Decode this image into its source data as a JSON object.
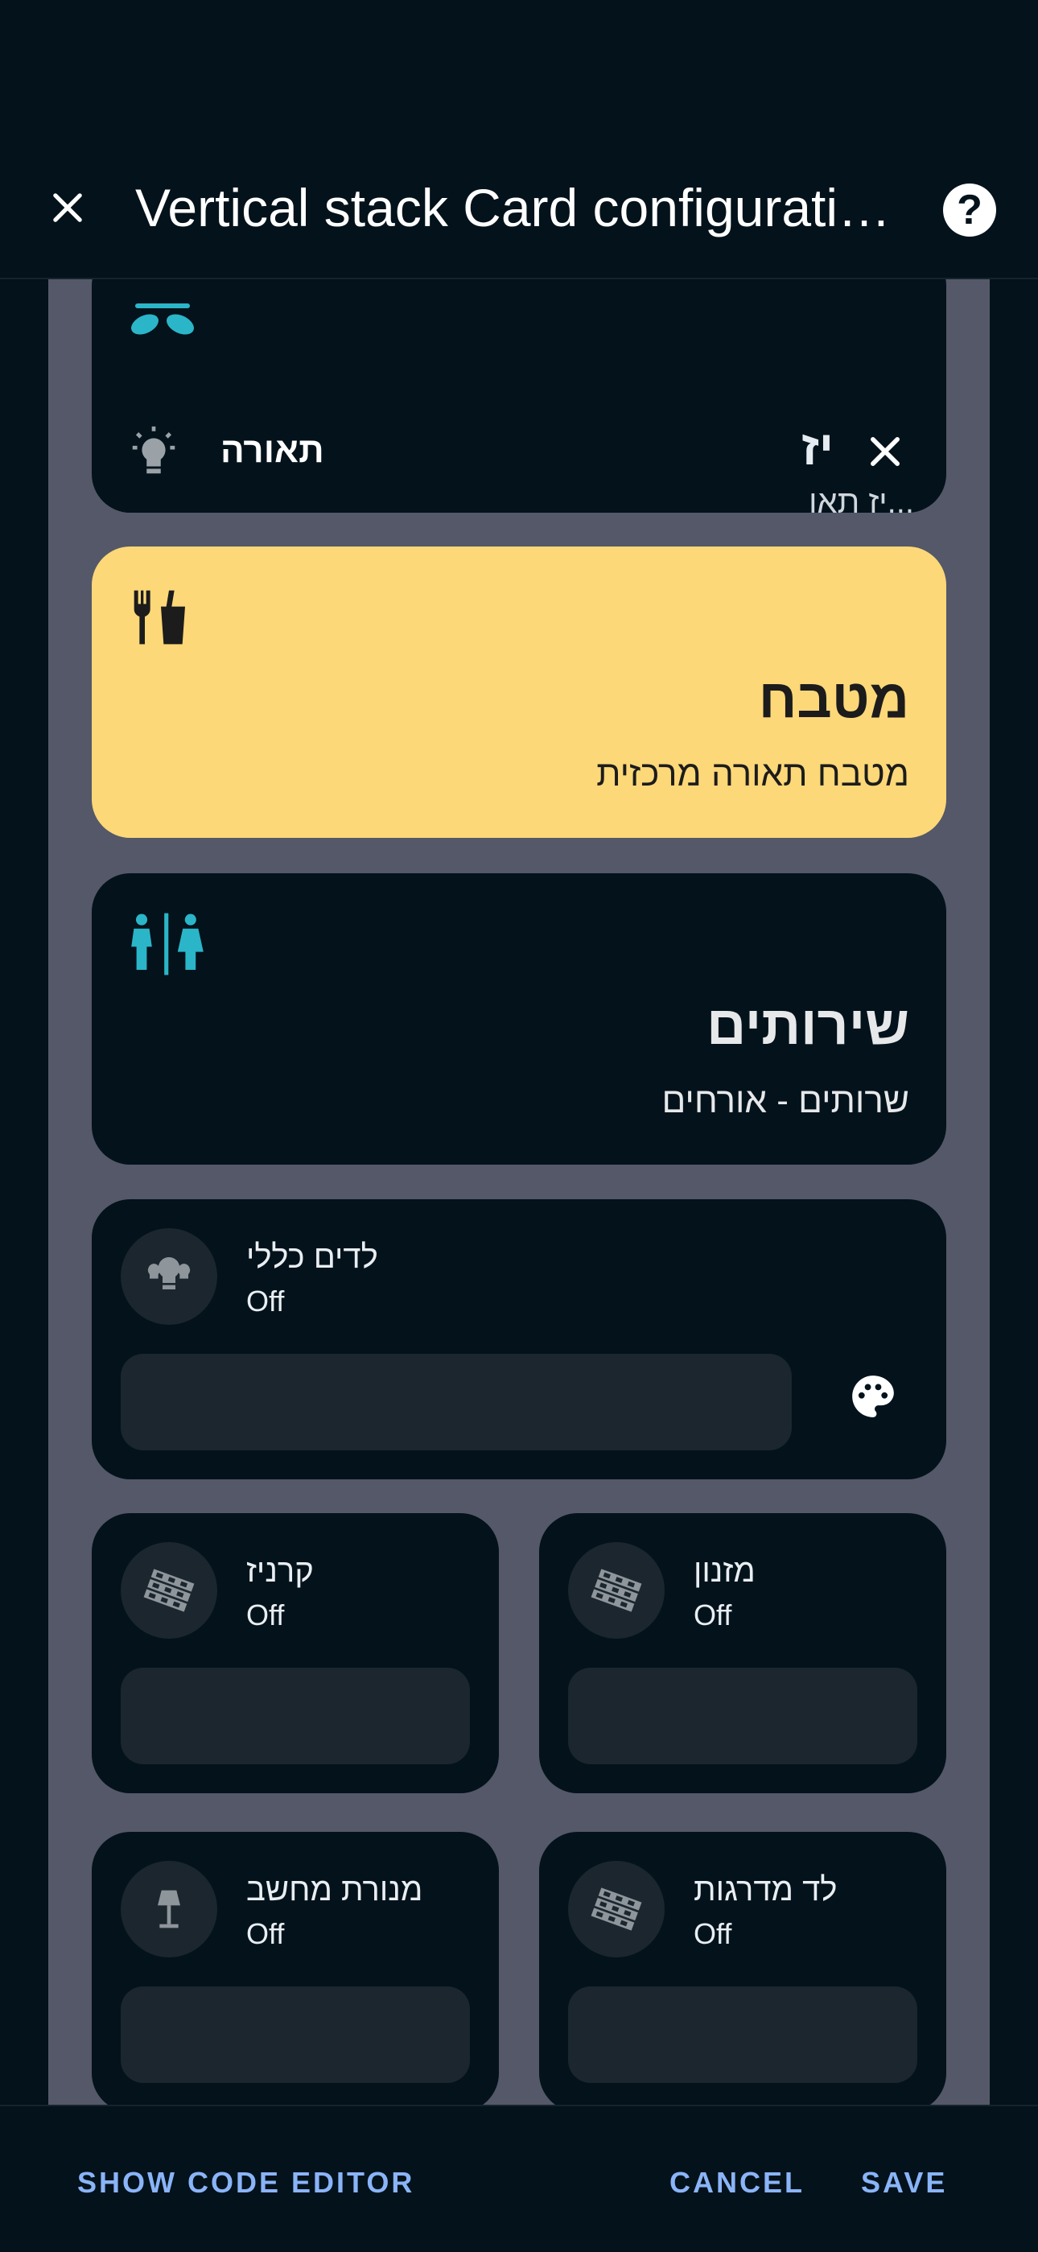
{
  "header": {
    "title": "Vertical stack Card configurati…",
    "close_icon": "close-icon",
    "help_icon": "help-icon",
    "help_glyph": "?"
  },
  "top_card": {
    "label": "תאורה",
    "partial_title": "יז",
    "subtitle": "...יז תאו",
    "icons": [
      "fan-ceiling-icon",
      "lightbulb-icon",
      "close-icon"
    ]
  },
  "area_cards": [
    {
      "name": "מטבח",
      "subtitle": "מטבח תאורה מרכזית",
      "icon": "food-drink-icon",
      "background": "#fdd878"
    },
    {
      "name": "שירותים",
      "subtitle": "שרותים - אורחים",
      "icon": "restroom-icon",
      "icon_color": "#2bb5c8"
    }
  ],
  "light_tile": {
    "name": "לדים כללי",
    "state": "Off",
    "icon": "led-lights-icon",
    "extra_icon": "palette-icon"
  },
  "tiles": [
    {
      "name": "קרניז",
      "state": "Off",
      "icon": "led-strip-icon"
    },
    {
      "name": "מזנון",
      "state": "Off",
      "icon": "led-strip-icon"
    },
    {
      "name": "מנורת מחשב",
      "state": "Off",
      "icon": "desk-lamp-icon"
    },
    {
      "name": "לד מדרגות",
      "state": "Off",
      "icon": "led-strip-icon"
    }
  ],
  "footer": {
    "show_code_label": "SHOW CODE EDITOR",
    "cancel_label": "CANCEL",
    "save_label": "SAVE",
    "accent": "#8ab4f8"
  }
}
